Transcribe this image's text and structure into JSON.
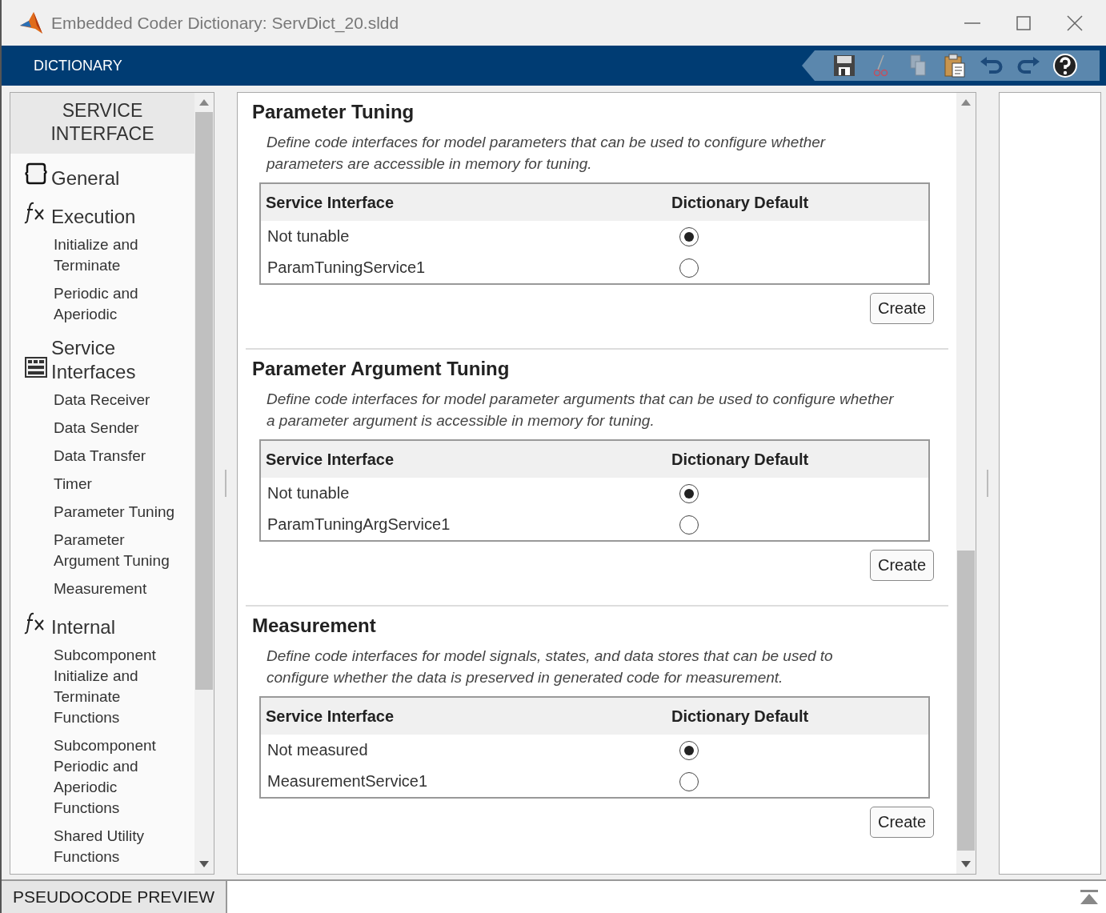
{
  "window": {
    "title": "Embedded Coder Dictionary: ServDict_20.sldd"
  },
  "toolstrip": {
    "tab": "DICTIONARY"
  },
  "sidebar": {
    "header": "SERVICE INTERFACE",
    "groups": [
      {
        "label": "General",
        "kind": "braces"
      },
      {
        "label": "Execution",
        "kind": "fx",
        "children": [
          {
            "label": "Initialize and Terminate"
          },
          {
            "label": "Periodic and Aperiodic"
          }
        ]
      },
      {
        "label": "Service Interfaces",
        "kind": "panel",
        "children": [
          {
            "label": "Data Receiver"
          },
          {
            "label": "Data Sender"
          },
          {
            "label": "Data Transfer"
          },
          {
            "label": "Timer"
          },
          {
            "label": "Parameter Tuning"
          },
          {
            "label": "Parameter Argument Tuning"
          },
          {
            "label": "Measurement"
          }
        ]
      },
      {
        "label": "Internal",
        "kind": "fx",
        "children": [
          {
            "label": "Subcomponent Initialize and Terminate Functions"
          },
          {
            "label": "Subcomponent Periodic and Aperiodic Functions"
          },
          {
            "label": "Shared Utility Functions"
          }
        ]
      }
    ]
  },
  "sections": [
    {
      "title": "Parameter Tuning",
      "description": "Define code interfaces for model parameters that can be used to configure whether parameters are accessible in memory for tuning.",
      "columns": [
        "Service Interface",
        "Dictionary Default"
      ],
      "rows": [
        {
          "label": "Not tunable",
          "selected": true
        },
        {
          "label": "ParamTuningService1",
          "selected": false
        }
      ],
      "button": "Create"
    },
    {
      "title": "Parameter Argument Tuning",
      "description": "Define code interfaces for model parameter arguments that can be used to configure whether a parameter argument is accessible in memory for tuning.",
      "columns": [
        "Service Interface",
        "Dictionary Default"
      ],
      "rows": [
        {
          "label": "Not tunable",
          "selected": true
        },
        {
          "label": "ParamTuningArgService1",
          "selected": false
        }
      ],
      "button": "Create"
    },
    {
      "title": "Measurement",
      "description": "Define code interfaces for model signals, states, and data stores that can be used to configure whether the data is preserved in generated code for measurement.",
      "columns": [
        "Service Interface",
        "Dictionary Default"
      ],
      "rows": [
        {
          "label": "Not measured",
          "selected": true
        },
        {
          "label": "MeasurementService1",
          "selected": false
        }
      ],
      "button": "Create"
    }
  ],
  "bottom_bar": {
    "tab": "PSEUDOCODE PREVIEW"
  }
}
